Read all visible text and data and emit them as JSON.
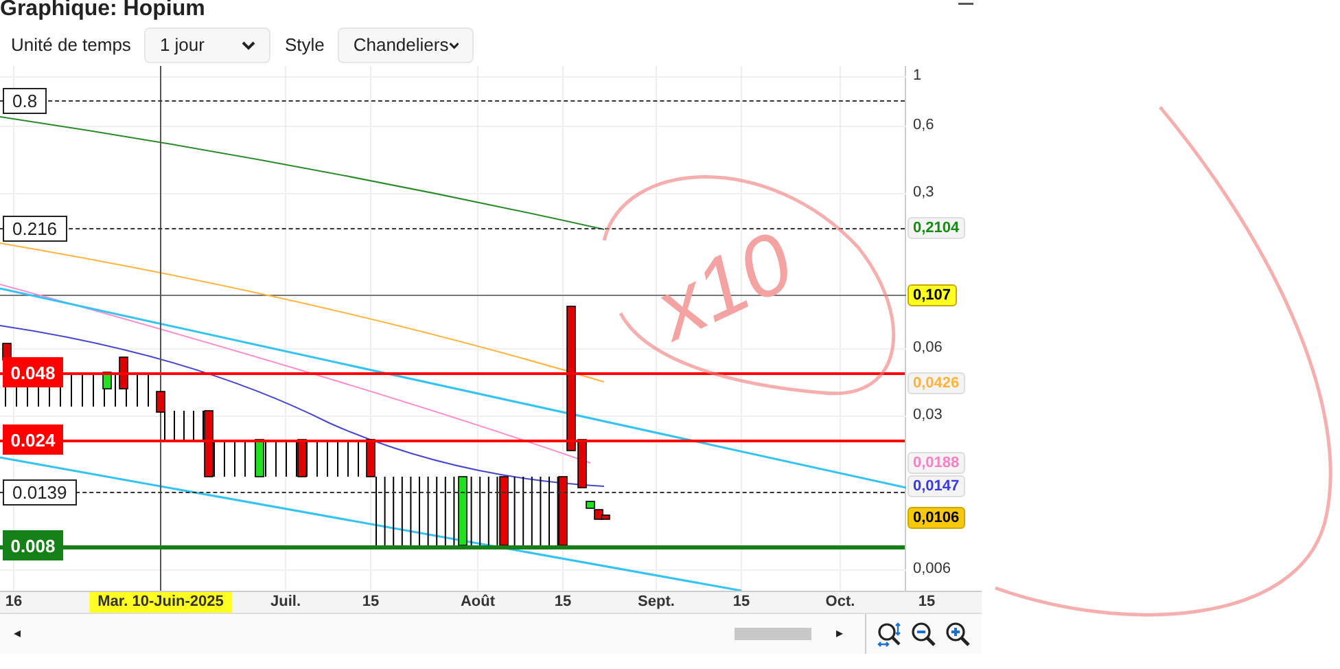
{
  "window": {
    "title": "Graphique: Hopium"
  },
  "controls": [
    {
      "label": "Unité de temps",
      "value": "1 jour"
    },
    {
      "label": "Style",
      "value": "Chandeliers"
    }
  ],
  "levels": [
    {
      "text": "0.8",
      "kind": "dashed"
    },
    {
      "text": "0.216",
      "kind": "dashed"
    },
    {
      "text": "0.048",
      "kind": "red"
    },
    {
      "text": "0.024",
      "kind": "red"
    },
    {
      "text": "0.0139",
      "kind": "dashed"
    },
    {
      "text": "0.008",
      "kind": "green"
    }
  ],
  "price_tags": [
    {
      "text": "0,2104",
      "color": "#168a16",
      "kind": "outline"
    },
    {
      "text": "0,107",
      "color": "#ffff22",
      "kind": "filled"
    },
    {
      "text": "0,0426",
      "color": "#ffb43c",
      "kind": "outline"
    },
    {
      "text": "0,0188",
      "color": "#ff7fc4",
      "kind": "outline"
    },
    {
      "text": "0,0147",
      "color": "#3a3ae0",
      "kind": "outline"
    },
    {
      "text": "0,0106",
      "color": "#f8c80c",
      "kind": "filled"
    }
  ],
  "y_ticks": [
    "1",
    "0,6",
    "0,3",
    "0,06",
    "0,03",
    "0,006"
  ],
  "x_ticks": [
    {
      "text": "16",
      "highlighted": false
    },
    {
      "text": "Mar. 10-Juin-2025",
      "highlighted": true
    },
    {
      "text": "Juil.",
      "highlighted": false
    },
    {
      "text": "15",
      "highlighted": false
    },
    {
      "text": "Août",
      "highlighted": false
    },
    {
      "text": "15",
      "highlighted": false
    },
    {
      "text": "Sept.",
      "highlighted": false
    },
    {
      "text": "15",
      "highlighted": false
    },
    {
      "text": "Oct.",
      "highlighted": false
    },
    {
      "text": "15",
      "highlighted": false
    }
  ],
  "scrollbar": {
    "left": "◂",
    "right": "▸"
  },
  "annotation": {
    "text": "x10"
  }
}
